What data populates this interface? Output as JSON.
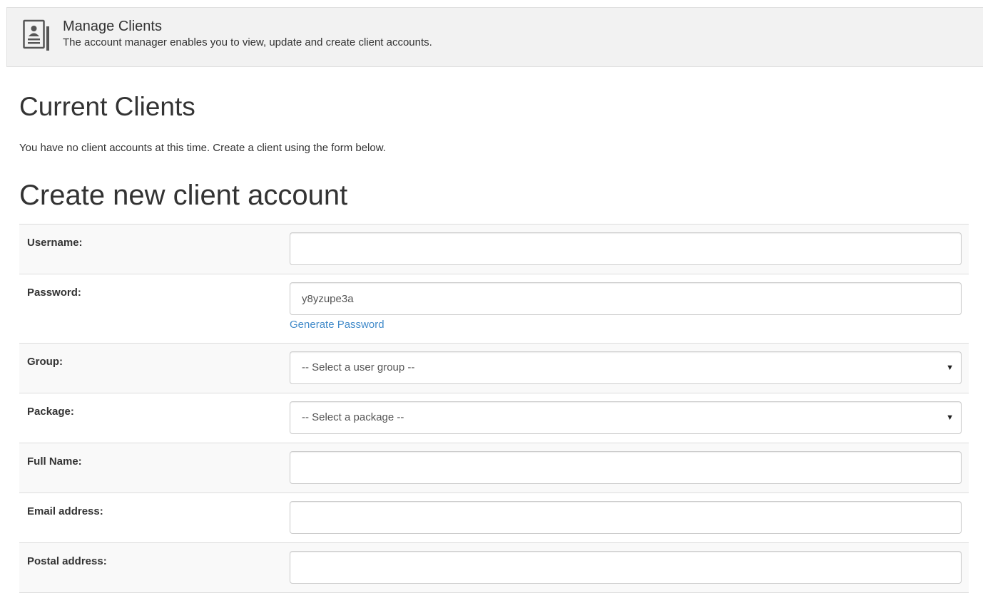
{
  "header": {
    "icon": "contact-card-icon",
    "title": "Manage Clients",
    "subtitle": "The account manager enables you to view, update and create client accounts."
  },
  "current_clients": {
    "title": "Current Clients",
    "message": "You have no client accounts at this time. Create a client using the form below."
  },
  "create_form": {
    "title": "Create new client account",
    "fields": {
      "username": {
        "label": "Username:",
        "value": "",
        "placeholder": ""
      },
      "password": {
        "label": "Password:",
        "value": "y8yzupe3a",
        "link": "Generate Password"
      },
      "group": {
        "label": "Group:",
        "selected": "-- Select a user group --"
      },
      "package": {
        "label": "Package:",
        "selected": "-- Select a package --"
      },
      "full_name": {
        "label": "Full Name:",
        "value": ""
      },
      "email": {
        "label": "Email address:",
        "value": ""
      },
      "postal": {
        "label": "Postal address:",
        "value": ""
      }
    }
  },
  "colors": {
    "header_bg": "#f2f2f2",
    "link": "#428bca",
    "row_alt": "#f9f9f9",
    "border": "#dddddd"
  }
}
